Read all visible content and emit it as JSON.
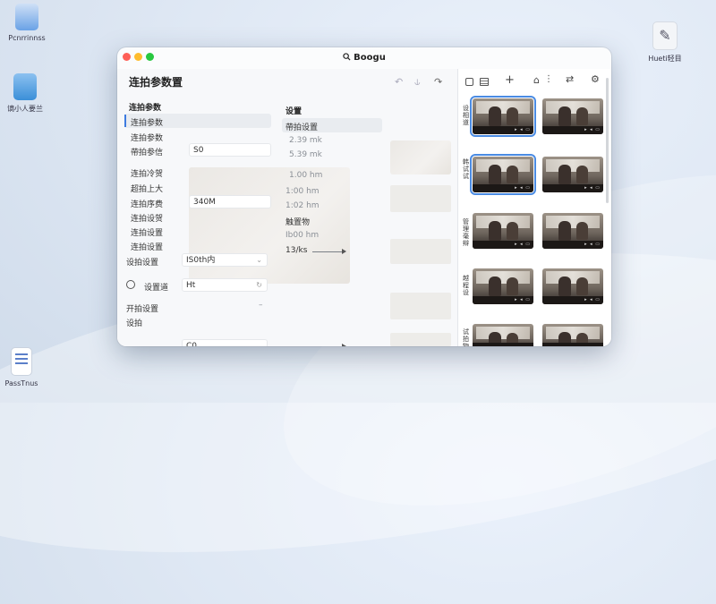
{
  "desktop": {
    "icons": [
      {
        "label": "Pcnrrinnss",
        "color": "#6aa2e6"
      },
      {
        "label": "谪小人要兰",
        "color": "#3b8fd8"
      },
      {
        "label": "PassTnus",
        "color": "#5b7fc9"
      },
      {
        "label": "Hueti轻目",
        "color": "#e8ecf2"
      }
    ]
  },
  "window": {
    "title": "Boogu",
    "heading": "连拍参数置",
    "toolbar_icons": [
      "undo-icon",
      "split-icon",
      "redo-icon"
    ],
    "left_section": {
      "title": "连拍参数",
      "items": [
        {
          "label": "连拍参数",
          "value": ""
        },
        {
          "label": "连拍参数",
          "value": ""
        },
        {
          "label": "帶拍参信",
          "value": "S0"
        },
        {
          "label": "连拍冷贺",
          "value": ""
        },
        {
          "label": "超拍上大",
          "value": ""
        },
        {
          "label": "连拍序费",
          "value": "340M"
        },
        {
          "label": "连拍设贺",
          "value": ""
        },
        {
          "label": "连拍设置",
          "value": ""
        },
        {
          "label": "连拍设置",
          "value": ""
        },
        {
          "label": "设拍设置",
          "value": "IS0th内"
        }
      ],
      "setting_row": {
        "label": "设置道",
        "value": "Ht"
      },
      "footer_items": [
        "开拍设置",
        "设拍"
      ],
      "bottom_value": "C0"
    },
    "right_section": {
      "title": "设置",
      "subtitle": "帶拍设置",
      "values": [
        "2.39 mk",
        "5.39 mk",
        "1.00 hm",
        "1:00 hm",
        "1:02 hm"
      ],
      "label": "触置物",
      "extra": [
        "Ib00 hm",
        "13/ks"
      ]
    }
  },
  "gallery": {
    "toolbar_icons": [
      "square-icon",
      "card-icon",
      "plus-icon",
      "home-icon",
      "more-icon",
      "sync-icon",
      "settings-icon"
    ],
    "side_labels": [
      "设相道",
      "韩试试",
      "管理毫辩",
      "越程设",
      "试拍物"
    ],
    "selected_thumbs": [
      0,
      2
    ]
  }
}
